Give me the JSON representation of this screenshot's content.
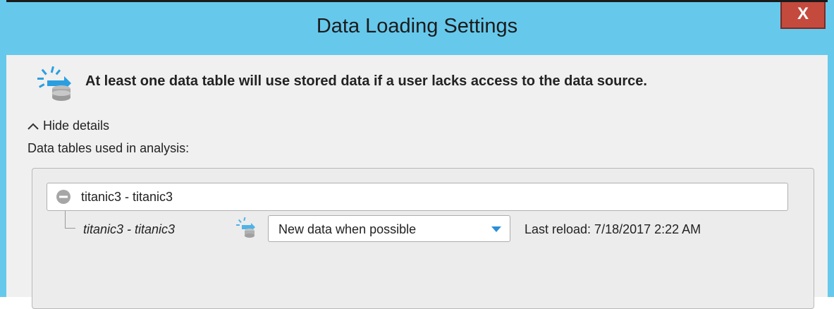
{
  "window": {
    "title": "Data Loading Settings",
    "close_label": "X"
  },
  "info": {
    "message": "At least one data table will use stored data if a user lacks access to the data source.",
    "icon": "stored-data-icon"
  },
  "details": {
    "toggle_label": "Hide details",
    "tables_label": "Data tables used in analysis:"
  },
  "tables": [
    {
      "name": "titanic3 - titanic3",
      "sources": [
        {
          "name": "titanic3 - titanic3",
          "mode": "New data when possible",
          "last_reload": "Last reload: 7/18/2017 2:22 AM"
        }
      ]
    }
  ],
  "colors": {
    "accent": "#66c9ec",
    "close": "#c44a3e",
    "dropdown_arrow": "#2a8fd8"
  }
}
